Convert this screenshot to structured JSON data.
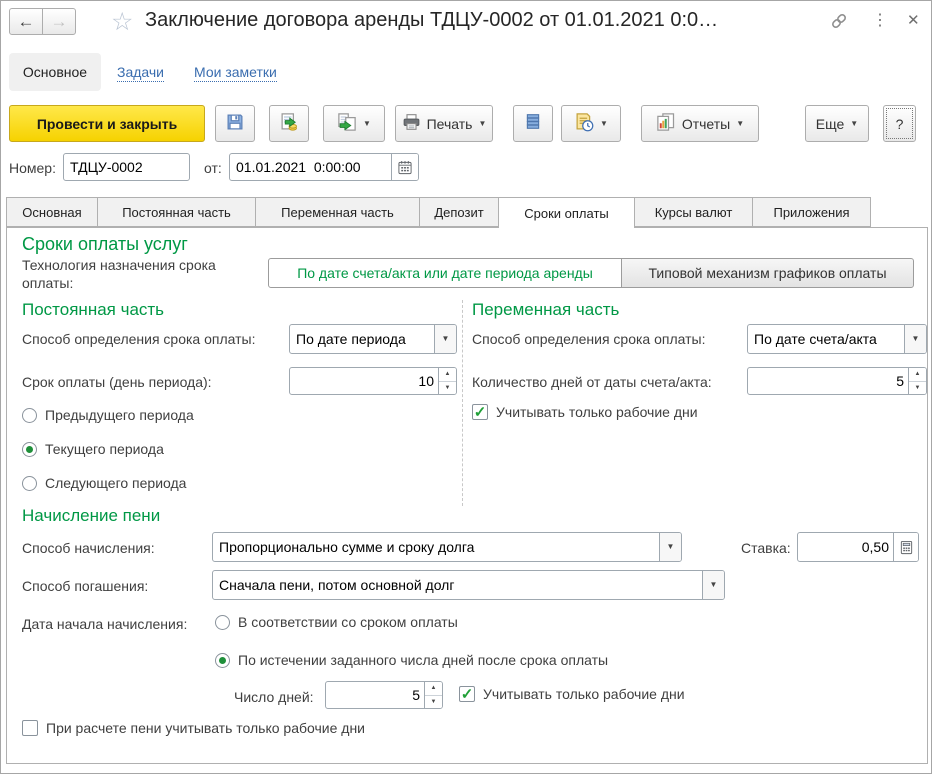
{
  "titlebar": {
    "title": "Заключение договора аренды ТДЦУ-0002 от 01.01.2021 0:0…"
  },
  "nav": {
    "items": [
      "Основное",
      "Задачи",
      "Мои заметки"
    ]
  },
  "toolbar": {
    "post_and_close": "Провести и закрыть",
    "print": "Печать",
    "reports": "Отчеты",
    "more": "Еще",
    "help": "?"
  },
  "doc": {
    "number_label": "Номер:",
    "number_value": "ТДЦУ-0002",
    "date_label": "от:",
    "date_value": "01.01.2021  0:00:00"
  },
  "tabs": {
    "items": [
      "Основная",
      "Постоянная часть",
      "Переменная часть",
      "Депозит",
      "Сроки оплаты",
      "Курсы валют",
      "Приложения"
    ],
    "active": "Сроки оплаты"
  },
  "content": {
    "section_title": "Сроки оплаты услуг",
    "tech_label_line1": "Технология назначения срока",
    "tech_label_line2": "оплаты:",
    "tech_options": [
      {
        "label": "По дате счета/акта или дате периода аренды",
        "selected": true
      },
      {
        "label": "Типовой механизм графиков оплаты",
        "selected": false
      }
    ],
    "fixed": {
      "title": "Постоянная часть",
      "method_label": "Способ определения срока оплаты:",
      "method_value": "По дате периода",
      "day_label": "Срок оплаты (день периода):",
      "day_value": "10",
      "radios": [
        {
          "label": "Предыдущего периода",
          "selected": false
        },
        {
          "label": "Текущего периода",
          "selected": true
        },
        {
          "label": "Следующего периода",
          "selected": false
        }
      ]
    },
    "variable": {
      "title": "Переменная часть",
      "method_label": "Способ определения срока оплаты:",
      "method_value": "По дате счета/акта",
      "days_label": "Количество дней от даты счета/акта:",
      "days_value": "5",
      "workdays_label": "Учитывать только рабочие дни",
      "workdays_checked": true
    },
    "penalty": {
      "title": "Начисление пени",
      "accrual_label": "Способ начисления:",
      "accrual_value": "Пропорционально сумме и сроку долга",
      "rate_label": "Ставка:",
      "rate_value": "0,50",
      "repay_label": "Способ погашения:",
      "repay_value": "Сначала пени, потом основной долг",
      "start_label": "Дата начала начисления:",
      "start_options": [
        {
          "label": "В соответствии со сроком оплаты",
          "selected": false
        },
        {
          "label": "По истечении заданного числа дней после срока оплаты",
          "selected": true
        }
      ],
      "days_label": "Число дней:",
      "days_value": "5",
      "workdays_label": "Учитывать только рабочие дни",
      "workdays_checked": true,
      "bottom_checkbox_label": "При расчете пени учитывать только рабочие дни",
      "bottom_checked": false
    }
  },
  "icons": {
    "back": "←",
    "forward": "→",
    "star": "☆",
    "kebab": "⋮",
    "close": "✕",
    "dropdown": "▼",
    "spin_up": "▲",
    "spin_down": "▼",
    "check": "✓"
  },
  "colors": {
    "accent_green": "#009845",
    "link_blue": "#3a6daf",
    "button_yellow": "#ffe13b",
    "selected_dot_green": "#1f8f3a"
  }
}
